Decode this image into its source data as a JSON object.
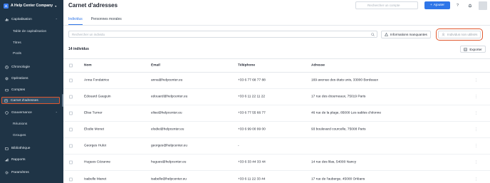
{
  "sidebar": {
    "company": "A Help Center Company",
    "logo_letter": "A",
    "sections": [
      {
        "label": "Capitalisation",
        "icon": "bar-chart-icon",
        "expanded": true,
        "items": [
          "Table de capitalisation",
          "Titres",
          "Pools"
        ]
      },
      {
        "label": "Chronologie",
        "icon": "clock-icon"
      },
      {
        "label": "Opérations",
        "icon": "gear-icon"
      },
      {
        "label": "Comptes",
        "icon": "wallet-icon"
      },
      {
        "label": "Carnet d'adresses",
        "icon": "address-book-icon",
        "active": true
      },
      {
        "label": "Gouvernance",
        "icon": "shield-icon",
        "expanded": true,
        "items": [
          "Réunions",
          "Groupes"
        ]
      },
      {
        "label": "Bibliothèque",
        "icon": "folder-icon"
      },
      {
        "label": "Rapports",
        "icon": "report-icon"
      },
      {
        "label": "Paramètres",
        "icon": "settings-icon"
      }
    ]
  },
  "header": {
    "title": "Carnet d'adresses",
    "search_placeholder": "Rechercher un compte",
    "add_label": "Ajouter"
  },
  "tabs": [
    {
      "label": "Individus",
      "active": true
    },
    {
      "label": "Personnes morales",
      "active": false
    }
  ],
  "filters": {
    "search_placeholder": "Rechercher un individu",
    "missing_info_label": "Informations manquantes",
    "unused_label": "Individus non utilisés"
  },
  "count_label": "14 individus",
  "export_label": "Exporter",
  "table": {
    "columns": [
      "Nom",
      "Email",
      "Téléphone",
      "Adresse"
    ],
    "rows": [
      {
        "name": "Anna Fondatrice",
        "email": "anna@helpcenter.eu",
        "phone": "+33 6 77 68 77 88",
        "address": "169 avenue des états unis, 33000 Bordeaux"
      },
      {
        "name": "Edouard Gauguin",
        "email": "edouard@helpcenter.eu",
        "phone": "+33 6 11 22 11 22",
        "address": "17 rue des étourneaux, 75019 Paris"
      },
      {
        "name": "Elise Turner",
        "email": "elise@helpcenter.eu",
        "phone": "+33 6 77 55 66 77",
        "address": "46 rue de la plage, 85000 Les sables d'olonne"
      },
      {
        "name": "Elodie Monet",
        "email": "elodie@helpcenter.eu",
        "phone": "+33 6 99 00 99 00",
        "address": "93 boulevard courcelle, 75008 Paris"
      },
      {
        "name": "Georges Hulot",
        "email": "georges@helpcenter.eu",
        "phone": "-",
        "address": ""
      },
      {
        "name": "Hugues Cézanne",
        "email": "hugues@helpcenter.eu",
        "phone": "+33 6 33 44 33 44",
        "address": "14 rue des lilas, 54000 Nancy"
      },
      {
        "name": "Isabelle Manet",
        "email": "isabelle@helpcenter.eu",
        "phone": "+33 6 11 22 33 44",
        "address": "17 rue de l'auberge, 45000 Orléans"
      }
    ]
  },
  "colors": {
    "sidebar_bg": "#1f3446",
    "accent": "#2f76e8",
    "highlight": "#e0572d"
  }
}
